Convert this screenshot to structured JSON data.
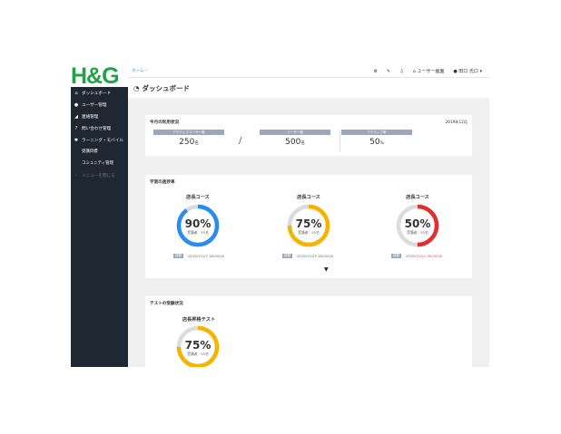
{
  "brand": {
    "logo_text": "H&G",
    "logo_color": "#1fa34a"
  },
  "sidebar": {
    "items": [
      {
        "icon": "home-icon",
        "glyph": "⌂",
        "label": "ダッシュボード"
      },
      {
        "icon": "user-icon",
        "glyph": "●",
        "label": "ユーザー管理"
      },
      {
        "icon": "megaphone-icon",
        "glyph": "◢",
        "label": "連絡管理"
      },
      {
        "icon": "question-icon",
        "glyph": "?",
        "label": "問い合わせ管理"
      },
      {
        "icon": "gear-icon",
        "glyph": "✱",
        "label": "ラーニング・モバイル"
      }
    ],
    "subitems": [
      "受講目標",
      "コミュニティ管理"
    ],
    "collapse": {
      "glyph": "‹",
      "label": "メニューを閉じる"
    }
  },
  "topbar": {
    "breadcrumb": "ホーム",
    "breadcrumb_sep": "/",
    "gear_glyph": "⚙",
    "wrench_glyph": "✎",
    "bell_glyph": "♫",
    "user_screen": "⌂ ユーザー画面",
    "user_name": "● 田口 氏口 ▾"
  },
  "page": {
    "title": "ダッシュボード",
    "title_icon": "◔"
  },
  "usage": {
    "title": "今月の利用状況",
    "date": "2019年12月",
    "active_users_label": "アクティブユーザー数",
    "active_users_value": "250",
    "active_users_unit": "名",
    "users_label": "ユーザー数",
    "users_value": "500",
    "users_unit": "名",
    "active_rate_label": "アクティブ率",
    "active_rate_value": "50",
    "active_rate_unit": "%",
    "slash": "/"
  },
  "progress": {
    "title": "学習の進捗率",
    "courses": [
      {
        "name": "店長コース",
        "percent": "90%",
        "value": 90,
        "color": "#2b8cf0",
        "students": "受講者：55名",
        "tag": "締期",
        "deadline": "2019/12/27 18:00:00",
        "overdue": false
      },
      {
        "name": "店長コース",
        "percent": "75%",
        "value": 75,
        "color": "#f6b300",
        "students": "受講者：55名",
        "tag": "締期",
        "deadline": "2019/12/25 18:00:00",
        "overdue": false
      },
      {
        "name": "店長コース",
        "percent": "50%",
        "value": 50,
        "color": "#e03030",
        "students": "受講者：55名",
        "tag": "締期",
        "deadline": "2019/12/20 18:00:00",
        "overdue": true
      }
    ],
    "expand_glyph": "▼"
  },
  "tests": {
    "title": "テストの受験状況",
    "items": [
      {
        "name": "店長昇格テスト",
        "percent": "75%",
        "value": 75,
        "color": "#f6b300",
        "students": "受講者：55名"
      }
    ]
  }
}
